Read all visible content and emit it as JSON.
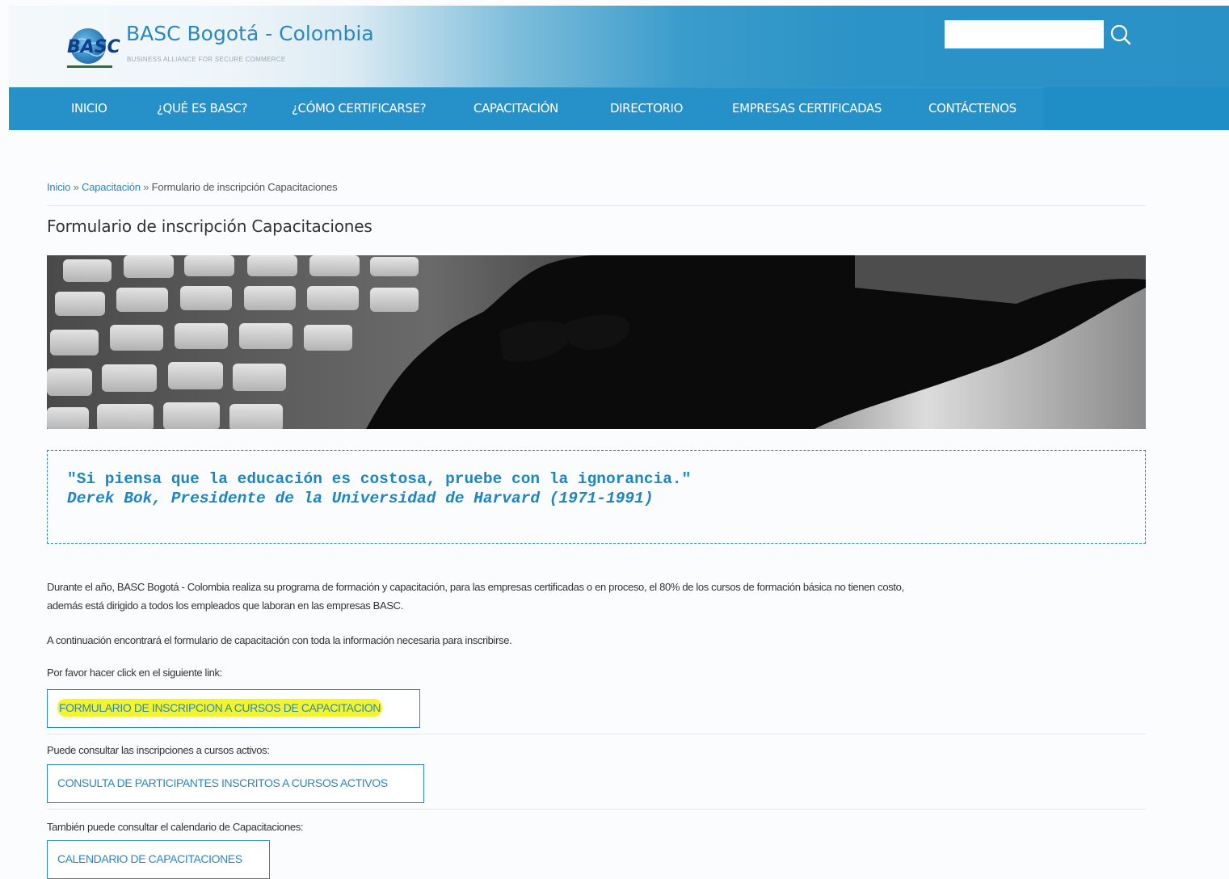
{
  "header": {
    "site_title": "BASC Bogotá - Colombia",
    "site_subtitle": "BUSINESS ALLIANCE FOR SECURE COMMERCE",
    "logo_text": "BASC",
    "search_placeholder": ""
  },
  "nav": {
    "items": [
      {
        "label": "INICIO"
      },
      {
        "label": "¿QUÉ ES BASC?"
      },
      {
        "label": "¿CÓMO CERTIFICARSE?"
      },
      {
        "label": "CAPACITACIÓN"
      },
      {
        "label": "DIRECTORIO"
      },
      {
        "label": "EMPRESAS CERTIFICADAS"
      },
      {
        "label": "CONTÁCTENOS"
      }
    ]
  },
  "breadcrumb": {
    "home": "Inicio",
    "section": "Capacitación",
    "current": "Formulario de inscripción Capacitaciones",
    "separator": "»"
  },
  "page": {
    "title": "Formulario de inscripción Capacitaciones",
    "quote_text": "\"Si piensa que la educación es costosa, pruebe con la ignorancia.\"",
    "quote_author": "Derek Bok, Presidente de la Universidad de Harvard (1971-1991)",
    "intro_line1": "Durante el año, BASC Bogotá - Colombia realiza su programa de formación y capacitación, para las empresas certificadas o en proceso, el 80% de los cursos de formación básica no tienen costo,",
    "intro_line2": "además está dirigido a todos los empleados que laboran en las empresas BASC.",
    "form_info": "A continuación encontrará el formulario de capacitación con toda la información necesaria para inscribirse.",
    "click_prompt": "Por favor hacer click en el siguiente link:",
    "form_link": "FORMULARIO DE INSCRIPCION A CURSOS DE CAPACITACION",
    "consult_prompt": "Puede consultar las inscripciones a cursos activos:",
    "consult_link": "CONSULTA DE PARTICIPANTES INSCRITOS A CURSOS ACTIVOS",
    "calendar_prompt": "También puede consultar el calendario de Capacitaciones:",
    "calendar_link": "CALENDARIO DE CAPACITACIONES"
  },
  "colors": {
    "brand_blue": "#2a87bf",
    "nav_blue": "#2591c8",
    "highlight_yellow": "#f4f42a"
  }
}
